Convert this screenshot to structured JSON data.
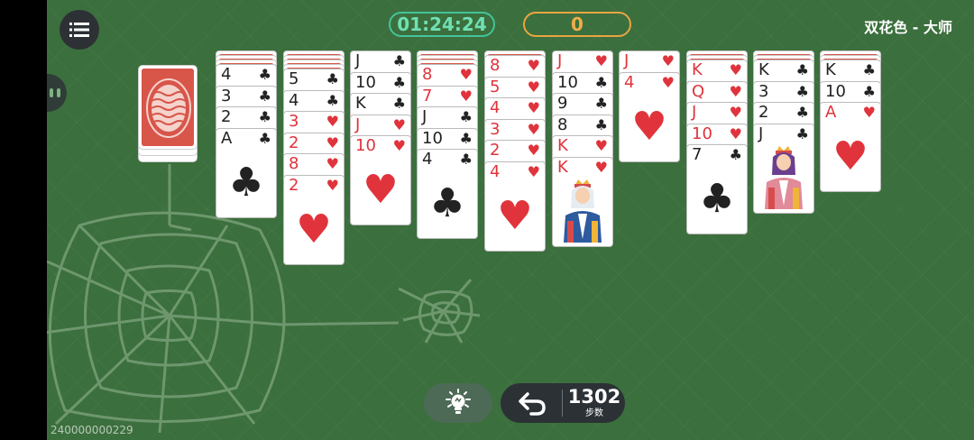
{
  "header": {
    "timer": "01:24:24",
    "score": "0",
    "mode": "双花色 - 大师"
  },
  "colors": {
    "felt": "#3b6f3d",
    "timer_accent": "#43c49a",
    "score_accent": "#e9a541",
    "red_suit": "#e0333b",
    "black_suit": "#222222"
  },
  "stock": {
    "piles": 3
  },
  "tableau": [
    {
      "hidden": 3,
      "cards": [
        {
          "rank": "4",
          "suit": "♣"
        },
        {
          "rank": "3",
          "suit": "♣"
        },
        {
          "rank": "2",
          "suit": "♣"
        },
        {
          "rank": "A",
          "suit": "♣",
          "face": "ace"
        }
      ]
    },
    {
      "hidden": 4,
      "cards": [
        {
          "rank": "5",
          "suit": "♣"
        },
        {
          "rank": "4",
          "suit": "♣"
        },
        {
          "rank": "3",
          "suit": "♥"
        },
        {
          "rank": "2",
          "suit": "♥"
        },
        {
          "rank": "8",
          "suit": "♥"
        },
        {
          "rank": "2",
          "suit": "♥"
        }
      ]
    },
    {
      "hidden": 0,
      "cards": [
        {
          "rank": "J",
          "suit": "♣"
        },
        {
          "rank": "10",
          "suit": "♣"
        },
        {
          "rank": "K",
          "suit": "♣"
        },
        {
          "rank": "J",
          "suit": "♥"
        },
        {
          "rank": "10",
          "suit": "♥"
        }
      ]
    },
    {
      "hidden": 3,
      "cards": [
        {
          "rank": "8",
          "suit": "♥"
        },
        {
          "rank": "7",
          "suit": "♥"
        },
        {
          "rank": "J",
          "suit": "♣"
        },
        {
          "rank": "10",
          "suit": "♣"
        },
        {
          "rank": "4",
          "suit": "♣"
        }
      ]
    },
    {
      "hidden": 1,
      "cards": [
        {
          "rank": "8",
          "suit": "♥"
        },
        {
          "rank": "5",
          "suit": "♥"
        },
        {
          "rank": "4",
          "suit": "♥"
        },
        {
          "rank": "3",
          "suit": "♥"
        },
        {
          "rank": "2",
          "suit": "♥"
        },
        {
          "rank": "4",
          "suit": "♥"
        }
      ]
    },
    {
      "hidden": 0,
      "cards": [
        {
          "rank": "J",
          "suit": "♥"
        },
        {
          "rank": "10",
          "suit": "♣"
        },
        {
          "rank": "9",
          "suit": "♣"
        },
        {
          "rank": "8",
          "suit": "♣"
        },
        {
          "rank": "K",
          "suit": "♥"
        },
        {
          "rank": "K",
          "suit": "♥",
          "face": "king"
        }
      ]
    },
    {
      "hidden": 0,
      "cards": [
        {
          "rank": "J",
          "suit": "♥"
        },
        {
          "rank": "4",
          "suit": "♥"
        }
      ]
    },
    {
      "hidden": 2,
      "cards": [
        {
          "rank": "K",
          "suit": "♥"
        },
        {
          "rank": "Q",
          "suit": "♥"
        },
        {
          "rank": "J",
          "suit": "♥"
        },
        {
          "rank": "10",
          "suit": "♥"
        },
        {
          "rank": "7",
          "suit": "♣"
        }
      ]
    },
    {
      "hidden": 2,
      "cards": [
        {
          "rank": "K",
          "suit": "♣"
        },
        {
          "rank": "3",
          "suit": "♣"
        },
        {
          "rank": "2",
          "suit": "♣"
        },
        {
          "rank": "J",
          "suit": "♣",
          "face": "jack"
        }
      ]
    },
    {
      "hidden": 2,
      "cards": [
        {
          "rank": "K",
          "suit": "♣"
        },
        {
          "rank": "10",
          "suit": "♣"
        },
        {
          "rank": "A",
          "suit": "♥",
          "face": "ace"
        }
      ]
    }
  ],
  "controls": {
    "hint_icon": "lightbulb-icon",
    "undo_icon": "undo-arrow-icon",
    "moves": "1302",
    "moves_label": "步数"
  },
  "game_id": "240000000229"
}
